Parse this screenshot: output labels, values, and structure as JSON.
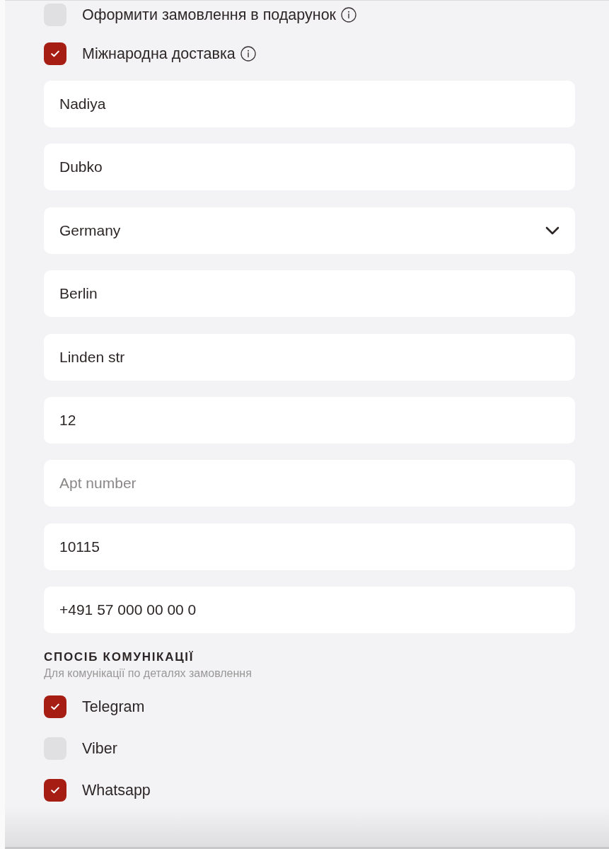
{
  "options": [
    {
      "label": "Оформити замовлення в подарунок",
      "checked": false,
      "info": true
    },
    {
      "label": "Міжнародна доставка",
      "checked": true,
      "info": true
    }
  ],
  "fields": [
    {
      "kind": "text",
      "value": "Nadiya"
    },
    {
      "kind": "text",
      "value": "Dubko"
    },
    {
      "kind": "select",
      "value": "Germany"
    },
    {
      "kind": "text",
      "value": "Berlin"
    },
    {
      "kind": "text",
      "value": "Linden str"
    },
    {
      "kind": "text",
      "value": "12"
    },
    {
      "kind": "text",
      "placeholder": "Apt number"
    },
    {
      "kind": "text",
      "value": "10115"
    },
    {
      "kind": "text",
      "value": "+491 57 000 00 00 0"
    }
  ],
  "communication": {
    "title": "СПОСІБ КОМУНІКАЦІЇ",
    "subtitle": "Для комунікації по деталях замовлення",
    "channels": [
      {
        "label": "Telegram",
        "checked": true
      },
      {
        "label": "Viber",
        "checked": false
      },
      {
        "label": "Whatsapp",
        "checked": true
      }
    ]
  }
}
